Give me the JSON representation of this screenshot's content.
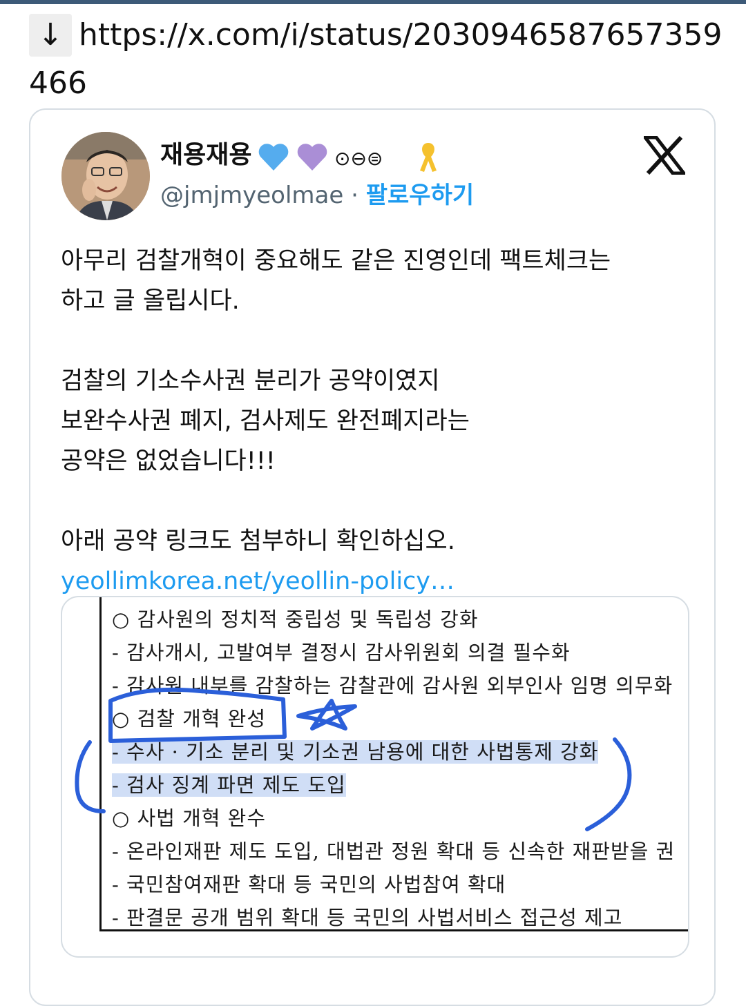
{
  "header": {
    "arrow_icon": "↓",
    "url_text": "https://x.com/i/status/2030946587657359466"
  },
  "tweet": {
    "display_name": "재용재용",
    "emoji_badges": [
      "blue-heart",
      "purple-heart",
      "circle-symbols",
      "yellow-ribbon"
    ],
    "symbols_text": "⊙⊖⊜",
    "handle": "@jmjmyeolmae",
    "separator": "·",
    "follow_label": "팔로우하기",
    "platform_icon": "x-logo",
    "paragraphs": [
      [
        "아무리 검찰개혁이 중요해도 같은 진영인데 팩트체크는",
        "하고 글 올립시다."
      ],
      [
        "검찰의 기소수사권 분리가 공약이였지",
        "보완수사권 폐지, 검사제도 완전폐지라는",
        "공약은 없었습니다!!!"
      ],
      [
        "아래 공약 링크도 첨부하니 확인하십오."
      ]
    ],
    "link_text": "yeollimkorea.net/yeollin-policy…"
  },
  "document_image": {
    "lines": [
      "○ 감사원의 정치적 중립성 및 독립성 강화",
      "- 감사개시, 고발여부 결정시 감사위원회 의결 필수화",
      "- 감사원 내부를 감찰하는 감찰관에 감사원 외부인사 임명 의무화",
      "○ 검찰 개혁 완성",
      "- 수사 · 기소 분리 및 기소권 남용에 대한 사법통제 강화",
      "- 검사 징계 파면 제도 도입",
      "○ 사법 개혁 완수",
      "- 온라인재판 제도 도입, 대법관 정원 확대 등 신속한 재판받을 권",
      "- 국민참여재판 확대 등 국민의 사법참여 확대",
      "- 판결문 공개 범위 확대 등 국민의 사법서비스 접근성 제고"
    ],
    "annotation_color": "#2b5fd9"
  }
}
